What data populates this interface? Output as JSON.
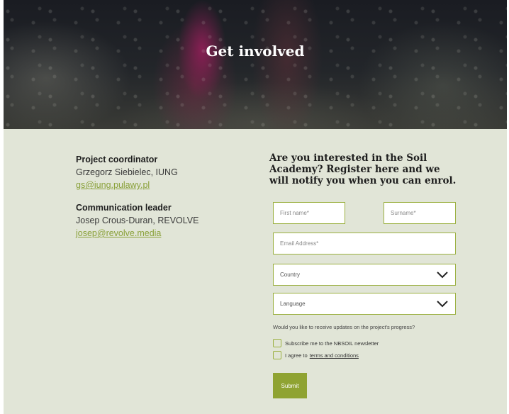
{
  "hero": {
    "title": "Get involved"
  },
  "contacts": [
    {
      "role": "Project coordinator",
      "name": "Grzegorz Siebielec, IUNG",
      "email": "gs@iung.pulawy.pl"
    },
    {
      "role": "Communication leader",
      "name": "Josep Crous-Duran, REVOLVE",
      "email": "josep@revolve.media"
    }
  ],
  "form": {
    "heading": "Are you interested in the Soil Academy? Register here and we will notify you when you can enrol.",
    "first_name_placeholder": "First name*",
    "surname_placeholder": "Surname*",
    "email_placeholder": "Email Address*",
    "country_label": "Country",
    "language_label": "Language",
    "question": "Would you like to receive updates on the project's progress?",
    "newsletter_label": "Subscribe me to the NBSOIL newsletter",
    "agree_prefix": "I agree to",
    "terms_link": "terms and conditions",
    "submit_label": "Submit"
  },
  "colors": {
    "accent": "#8fa332",
    "background": "#e1e5d7"
  },
  "icons": {
    "select_chevron": "chevron-down-icon"
  }
}
